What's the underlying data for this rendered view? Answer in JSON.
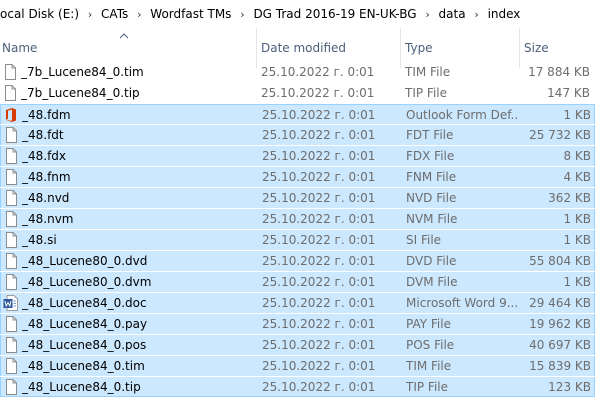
{
  "breadcrumb": [
    "ocal Disk (E:)",
    "CATs",
    "Wordfast TMs",
    "DG Trad 2016-19 EN-UK-BG",
    "data",
    "index"
  ],
  "columns": {
    "name": "Name",
    "date": "Date modified",
    "type": "Type",
    "size": "Size"
  },
  "files": [
    {
      "name": "_7b_Lucene84_0.tim",
      "date": "25.10.2022 г. 0:01",
      "type": "TIM File",
      "size": "17 884 KB",
      "icon": "blank-file-icon",
      "selected": false
    },
    {
      "name": "_7b_Lucene84_0.tip",
      "date": "25.10.2022 г. 0:01",
      "type": "TIP File",
      "size": "147 KB",
      "icon": "blank-file-icon",
      "selected": false
    },
    {
      "name": "_48.fdm",
      "date": "25.10.2022 г. 0:01",
      "type": "Outlook Form Def...",
      "size": "1 KB",
      "icon": "office-icon",
      "selected": true
    },
    {
      "name": "_48.fdt",
      "date": "25.10.2022 г. 0:01",
      "type": "FDT File",
      "size": "25 732 KB",
      "icon": "blank-file-icon",
      "selected": true
    },
    {
      "name": "_48.fdx",
      "date": "25.10.2022 г. 0:01",
      "type": "FDX File",
      "size": "8 KB",
      "icon": "blank-file-icon",
      "selected": true
    },
    {
      "name": "_48.fnm",
      "date": "25.10.2022 г. 0:01",
      "type": "FNM File",
      "size": "4 KB",
      "icon": "blank-file-icon",
      "selected": true
    },
    {
      "name": "_48.nvd",
      "date": "25.10.2022 г. 0:01",
      "type": "NVD File",
      "size": "362 KB",
      "icon": "blank-file-icon",
      "selected": true
    },
    {
      "name": "_48.nvm",
      "date": "25.10.2022 г. 0:01",
      "type": "NVM File",
      "size": "1 KB",
      "icon": "blank-file-icon",
      "selected": true
    },
    {
      "name": "_48.si",
      "date": "25.10.2022 г. 0:01",
      "type": "SI File",
      "size": "1 KB",
      "icon": "blank-file-icon",
      "selected": true
    },
    {
      "name": "_48_Lucene80_0.dvd",
      "date": "25.10.2022 г. 0:01",
      "type": "DVD File",
      "size": "55 804 KB",
      "icon": "blank-file-icon",
      "selected": true
    },
    {
      "name": "_48_Lucene80_0.dvm",
      "date": "25.10.2022 г. 0:01",
      "type": "DVM File",
      "size": "1 KB",
      "icon": "blank-file-icon",
      "selected": true
    },
    {
      "name": "_48_Lucene84_0.doc",
      "date": "25.10.2022 г. 0:01",
      "type": "Microsoft Word 9...",
      "size": "29 464 KB",
      "icon": "word-doc-icon",
      "selected": true
    },
    {
      "name": "_48_Lucene84_0.pay",
      "date": "25.10.2022 г. 0:01",
      "type": "PAY File",
      "size": "19 962 KB",
      "icon": "blank-file-icon",
      "selected": true
    },
    {
      "name": "_48_Lucene84_0.pos",
      "date": "25.10.2022 г. 0:01",
      "type": "POS File",
      "size": "40 697 KB",
      "icon": "blank-file-icon",
      "selected": true
    },
    {
      "name": "_48_Lucene84_0.tim",
      "date": "25.10.2022 г. 0:01",
      "type": "TIM File",
      "size": "15 839 KB",
      "icon": "blank-file-icon",
      "selected": true
    },
    {
      "name": "_48_Lucene84_0.tip",
      "date": "25.10.2022 г. 0:01",
      "type": "TIP File",
      "size": "123 KB",
      "icon": "blank-file-icon",
      "selected": true
    }
  ],
  "colors": {
    "selection_bg": "#cce8ff",
    "selection_border": "#99d1ff",
    "header_text": "#4c607a",
    "meta_text": "#6d6d6d"
  }
}
